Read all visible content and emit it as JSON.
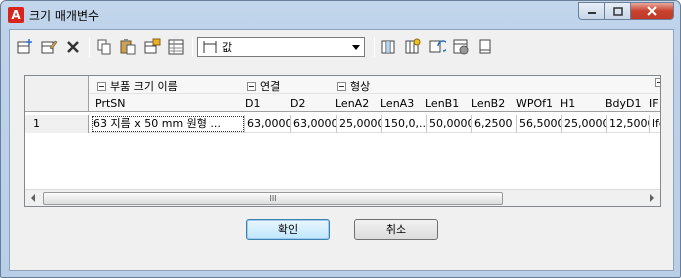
{
  "window": {
    "title": "크기 매개변수",
    "logo_letter": "A"
  },
  "toolbar": {
    "combo_value": "값"
  },
  "grid": {
    "groups": [
      {
        "label": "부품 크기 이름"
      },
      {
        "label": "연결"
      },
      {
        "label": "형상"
      }
    ],
    "columns": [
      "PrtSN",
      "D1",
      "D2",
      "LenA2",
      "LenA3",
      "LenB1",
      "LenB2",
      "WPOf1",
      "H1",
      "BdyD1",
      "IF"
    ],
    "rows": [
      {
        "row_number": "1",
        "cells": [
          "63 지름 x 50 mm 원형 ...",
          "63,0000",
          "63,0000",
          "25,0000",
          "150,0,...",
          "50,0000",
          "6,2500",
          "56,5000",
          "25,0000",
          "12,5000",
          "lfc"
        ]
      }
    ]
  },
  "buttons": {
    "ok": "확인",
    "cancel": "취소"
  },
  "scrollbar": {
    "thumb_grip": "III"
  }
}
